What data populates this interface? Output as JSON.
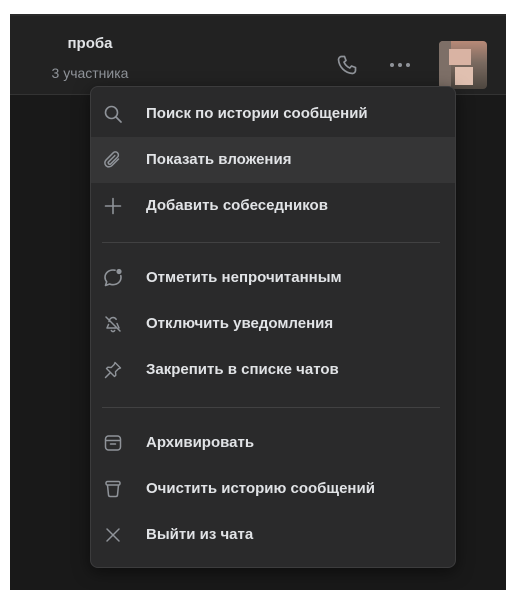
{
  "header": {
    "title": "проба",
    "subtitle": "3 участника"
  },
  "menu": {
    "groups": [
      [
        {
          "label": "Поиск по истории сообщений",
          "icon": "search-icon"
        },
        {
          "label": "Показать вложения",
          "icon": "paperclip-icon",
          "highlighted": true
        },
        {
          "label": "Добавить собеседников",
          "icon": "plus-icon"
        }
      ],
      [
        {
          "label": "Отметить непрочитанным",
          "icon": "unread-bubble-icon"
        },
        {
          "label": "Отключить уведомления",
          "icon": "bell-off-icon"
        },
        {
          "label": "Закрепить в списке чатов",
          "icon": "pin-icon"
        }
      ],
      [
        {
          "label": "Архивировать",
          "icon": "archive-icon"
        },
        {
          "label": "Очистить историю сообщений",
          "icon": "trash-icon"
        },
        {
          "label": "Выйти из чата",
          "icon": "close-icon"
        }
      ]
    ]
  },
  "colors": {
    "background": "#191919",
    "menu_background": "#2a2a2b",
    "text": "#e1e3e6",
    "muted_text": "#8f9399",
    "icon": "#8f9399"
  }
}
